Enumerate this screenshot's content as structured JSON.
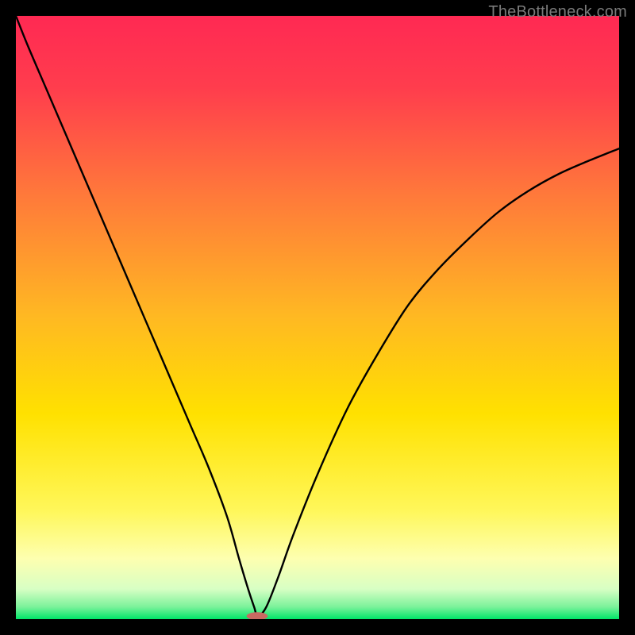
{
  "watermark": "TheBottleneck.com",
  "chart_data": {
    "type": "line",
    "title": "",
    "xlabel": "",
    "ylabel": "",
    "xlim": [
      0,
      100
    ],
    "ylim": [
      0,
      100
    ],
    "grid": false,
    "legend": false,
    "background_gradient": {
      "top_color": "#ff2953",
      "mid_color": "#ffd900",
      "bottom_color": "#00e568"
    },
    "series": [
      {
        "name": "curve",
        "color": "#000000",
        "x": [
          0,
          2,
          5,
          8,
          11,
          14,
          17,
          20,
          23,
          26,
          29,
          32,
          35,
          37,
          38.5,
          39.5,
          40.1,
          41.5,
          43.5,
          46,
          50,
          55,
          60,
          65,
          70,
          75,
          80,
          85,
          90,
          95,
          100
        ],
        "y": [
          100,
          95,
          88,
          81,
          74,
          67,
          60,
          53,
          46,
          39,
          32,
          25,
          17,
          10,
          5,
          2,
          0.5,
          2,
          7,
          14,
          24,
          35,
          44,
          52,
          58,
          63,
          67.5,
          71,
          73.8,
          76,
          78
        ]
      }
    ],
    "marker": {
      "name": "min-point",
      "x": 40,
      "y": 0.5,
      "width_pct": 3.5,
      "height_pct": 1.3,
      "color": "#c96a62"
    }
  }
}
